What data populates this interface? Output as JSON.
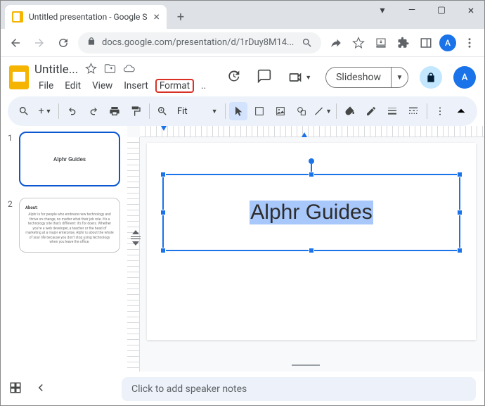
{
  "browser": {
    "tab_title": "Untitled presentation - Google S",
    "url": "docs.google.com/presentation/d/1rDuy8M14...",
    "avatar_initial": "A"
  },
  "doc": {
    "title": "Untitle...",
    "menus": {
      "file": "File",
      "edit": "Edit",
      "view": "View",
      "insert": "Insert",
      "format": "Format"
    },
    "slideshow_label": "Slideshow",
    "avatar_initial": "A"
  },
  "toolbar": {
    "zoom_label": "Fit"
  },
  "thumbs": [
    {
      "index": "1",
      "title": "Alphr Guides"
    },
    {
      "index": "2",
      "heading": "About:",
      "body": "Alphr is for people who embrace new technology and thrive on change, no matter what their job role. It's a technology site that's different: it's for doers. Whether you're a web developer, a teacher or the head of marketing at a major enterprise, Alphr is about the whole of your life because you don't stop using technology when you leave the office."
    }
  ],
  "slide": {
    "textbox_text": "Alphr Guides"
  },
  "notes": {
    "placeholder": "Click to add speaker notes"
  }
}
